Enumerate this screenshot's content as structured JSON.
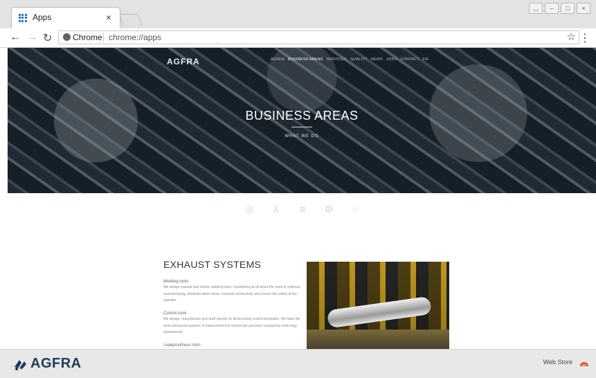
{
  "browser": {
    "tab_title": "Apps",
    "tab_close": "×",
    "site_name": "Chrome",
    "url": "chrome://apps"
  },
  "hero": {
    "logo": "AGFRA",
    "nav": [
      "AGFRA",
      "BUSINESS AREAS",
      "SERVICES",
      "QUALITY",
      "NEWS",
      "JOBS",
      "CONTACT",
      "EN"
    ],
    "title": "BUSINESS AREAS",
    "subtitle": "WHAT WE DO"
  },
  "content": {
    "section_title": "EXHAUST SYSTEMS",
    "blocks": [
      {
        "heading": "Welding tools",
        "text": "We design manual and robotic welding tools, considering at all times the need to optimise manufacturing, eliminate down times, increase productivity and ensure the safety of the operator."
      },
      {
        "heading": "Control tools",
        "text": "We design, manufacture and draft reports on dimensional control templates. We have the most advanced systems of measurement to ensure the precision required by metrology departments."
      },
      {
        "heading": "Leakproofness tools",
        "text": ""
      }
    ]
  },
  "shelf": {
    "logo_text": "AGFRA",
    "webstore": "Web Store"
  },
  "icons": [
    "target-icon",
    "wrench-icon",
    "antenna-icon",
    "gear-icon",
    "ring-icon"
  ]
}
